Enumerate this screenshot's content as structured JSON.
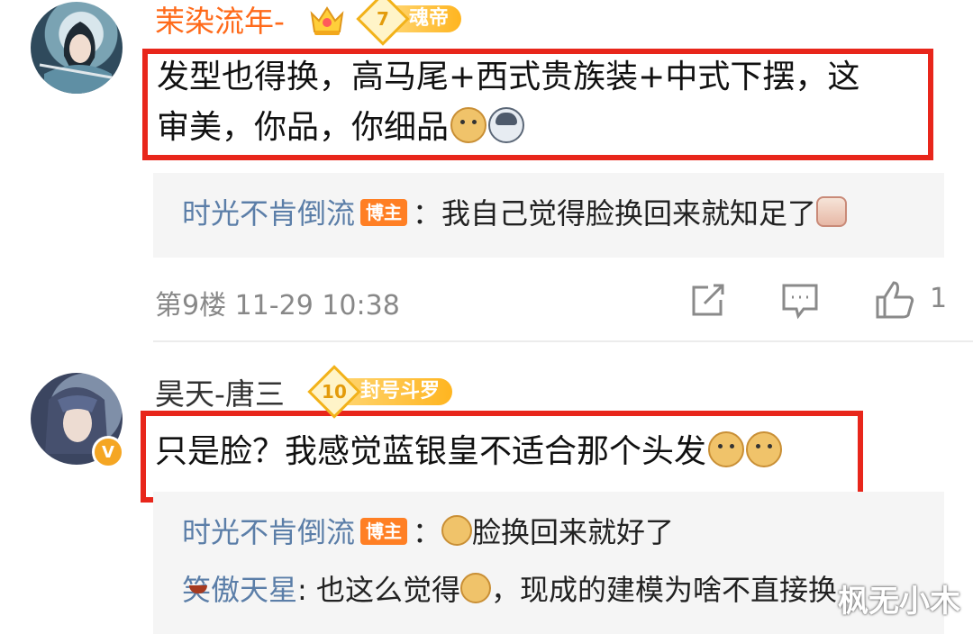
{
  "comments": [
    {
      "username": "茉染流年-",
      "level_number": "7",
      "level_title": "魂帝",
      "text_line1": "发型也得换，高马尾+西式贵族装+中式下摆，这",
      "text_line2": "审美，你品，你细品",
      "reply": {
        "author": "时光不肯倒流",
        "author_badge": "博主",
        "text": "：我自己觉得脸换回来就知足了"
      },
      "floor_time": "第9楼  11-29 10:38",
      "like_count": "1"
    },
    {
      "username": "昊天-唐三",
      "level_number": "10",
      "level_title": "封号斗罗",
      "verified_badge": "V",
      "text": "只是脸？我感觉蓝银皇不适合那个头发",
      "replies": [
        {
          "author": "时光不肯倒流",
          "author_badge": "博主",
          "separator": "：",
          "text": "脸换回来就好了"
        },
        {
          "author": "笑傲天星",
          "separator": ":",
          "text_before": " 也这么觉得",
          "text_after": "，现成的建模为啥不直接换"
        }
      ]
    }
  ],
  "watermark": "枫无小木",
  "colors": {
    "highlight_border": "#e8261b",
    "username_orange": "#ff6a1a",
    "reply_name": "#5b7ea8",
    "badge_orange": "#ff7f24"
  },
  "icons": [
    "crown-icon",
    "level-diamond-icon",
    "doge-emoji",
    "husky-emoji",
    "cup-bunny-emoji",
    "laugh-cry-emoji",
    "repost-icon",
    "comment-icon",
    "like-icon"
  ]
}
